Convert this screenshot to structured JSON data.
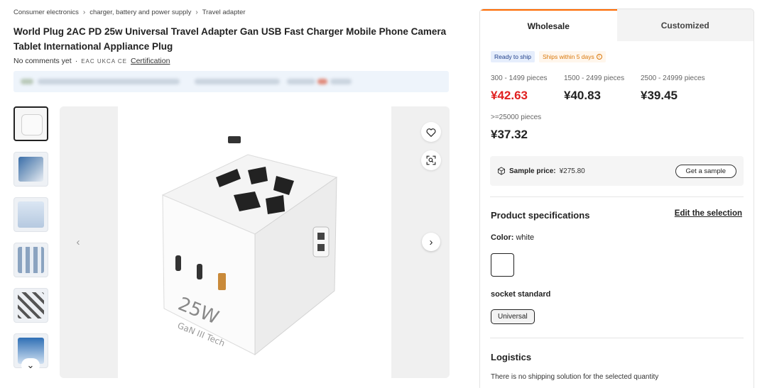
{
  "breadcrumb": [
    "Consumer electronics",
    "charger, battery and power supply",
    "Travel adapter"
  ],
  "product": {
    "title": "World Plug 2AC PD 25w Universal Travel Adapter Gan USB Fast Charger Mobile Phone Camera Tablet International Appliance Plug",
    "reviews": "No comments yet",
    "meta_sep": "·",
    "cert_icons": "EAC UKCA CE",
    "certification_label": "Certification"
  },
  "gallery": {
    "thumbnail_count": 6,
    "active_index": 0
  },
  "purchase": {
    "tabs": [
      {
        "label": "Wholesale",
        "active": true
      },
      {
        "label": "Customized",
        "active": false
      }
    ],
    "badges": {
      "ready": "Ready to ship",
      "ships": "Ships within 5 days"
    },
    "tiers": [
      {
        "range": "300 - 1499 pieces",
        "price": "¥42.63"
      },
      {
        "range": "1500 - 2499 pieces",
        "price": "¥40.83"
      },
      {
        "range": "2500 - 24999 pieces",
        "price": "¥39.45"
      },
      {
        "range": ">=25000 pieces",
        "price": "¥37.32"
      }
    ],
    "sample": {
      "label": "Sample price:",
      "value": "¥275.80",
      "button": "Get a sample"
    }
  },
  "specs": {
    "title": "Product specifications",
    "edit_label": "Edit the selection",
    "color_label": "Color:",
    "color_value": "white",
    "socket_label": "socket standard",
    "socket_value": "Universal"
  },
  "logistics": {
    "title": "Logistics",
    "message": "There is no shipping solution for the selected quantity"
  },
  "colors": {
    "accent": "#ff6a00",
    "price_red": "#e02020",
    "ready_bg": "#e6eefc",
    "ships_text": "#d9770a"
  }
}
